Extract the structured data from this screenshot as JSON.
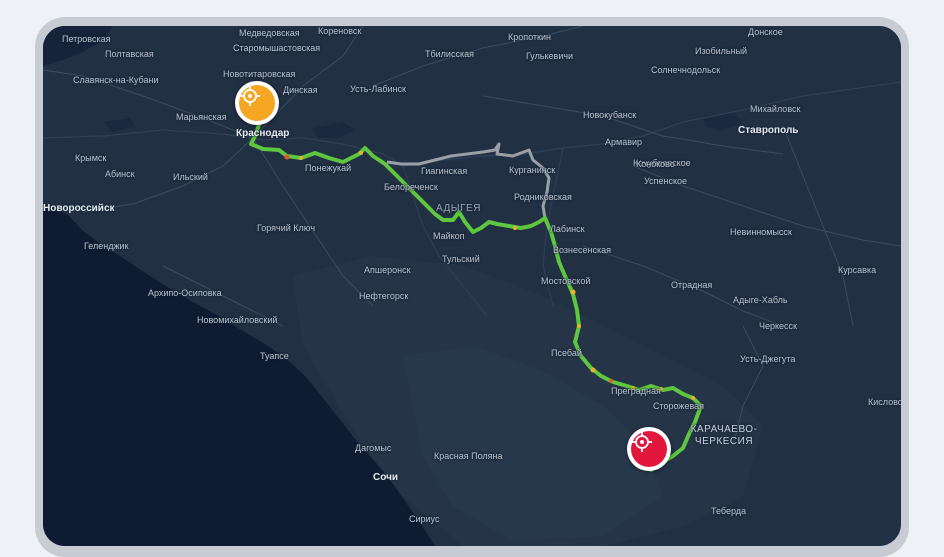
{
  "colors": {
    "water": "#0f1b33",
    "land": "#223044",
    "route": "#5ec63f",
    "alt_route": "#9aa0a7",
    "start_marker": "#f5a623",
    "end_marker": "#e3173e"
  },
  "markers": {
    "start_icon": "crosshair-target-icon",
    "end_icon": "crosshair-target-icon"
  },
  "map_labels": [
    {
      "text": "Петровская",
      "kind": "town"
    },
    {
      "text": "Полтавская",
      "kind": "town"
    },
    {
      "text": "Медведовская",
      "kind": "town"
    },
    {
      "text": "Кореновск",
      "kind": "town"
    },
    {
      "text": "Старомышастовская",
      "kind": "town"
    },
    {
      "text": "Славянск-на-Кубани",
      "kind": "town"
    },
    {
      "text": "Новотитаровская",
      "kind": "town"
    },
    {
      "text": "Динская",
      "kind": "town"
    },
    {
      "text": "Усть-Лабинск",
      "kind": "town"
    },
    {
      "text": "Тбилисская",
      "kind": "town"
    },
    {
      "text": "Кропоткин",
      "kind": "town"
    },
    {
      "text": "Гулькевичи",
      "kind": "town"
    },
    {
      "text": "Донское",
      "kind": "town"
    },
    {
      "text": "Изобильный",
      "kind": "town"
    },
    {
      "text": "Солнечнодольск",
      "kind": "town"
    },
    {
      "text": "Михайловск",
      "kind": "town"
    },
    {
      "text": "Ставрополь",
      "kind": "city"
    },
    {
      "text": "Марьянская",
      "kind": "town"
    },
    {
      "text": "Краснодар",
      "kind": "city"
    },
    {
      "text": "Новокубанск",
      "kind": "town"
    },
    {
      "text": "Армавир",
      "kind": "town"
    },
    {
      "text": "Крымск",
      "kind": "town"
    },
    {
      "text": "Абинск",
      "kind": "town"
    },
    {
      "text": "Ильский",
      "kind": "town"
    },
    {
      "text": "Понежукай",
      "kind": "town"
    },
    {
      "text": "Гиагинская",
      "kind": "town"
    },
    {
      "text": "Курганинск",
      "kind": "town"
    },
    {
      "text": "Кочубеевское",
      "kind": "town"
    },
    {
      "text": "Конокoво",
      "kind": "town"
    },
    {
      "text": "Успенское",
      "kind": "town"
    },
    {
      "text": "Белореченск",
      "kind": "town"
    },
    {
      "text": "Родниковская",
      "kind": "town"
    },
    {
      "text": "Новороссийск",
      "kind": "city"
    },
    {
      "text": "АДЫГЕЯ",
      "kind": "region"
    },
    {
      "text": "Геленджик",
      "kind": "town"
    },
    {
      "text": "Горячий Ключ",
      "kind": "town"
    },
    {
      "text": "Майкоп",
      "kind": "town"
    },
    {
      "text": "Лабинск",
      "kind": "town"
    },
    {
      "text": "Невинномысск",
      "kind": "town"
    },
    {
      "text": "Тульский",
      "kind": "town"
    },
    {
      "text": "Вознесенская",
      "kind": "town"
    },
    {
      "text": "Апшеронск",
      "kind": "town"
    },
    {
      "text": "Курсавка",
      "kind": "town"
    },
    {
      "text": "Архипо-Осиповка",
      "kind": "town"
    },
    {
      "text": "Нефтегорск",
      "kind": "town"
    },
    {
      "text": "Мостовской",
      "kind": "town"
    },
    {
      "text": "Отрадная",
      "kind": "town"
    },
    {
      "text": "Адыге-Хабль",
      "kind": "town"
    },
    {
      "text": "Новомихайловский",
      "kind": "town"
    },
    {
      "text": "Черкесск",
      "kind": "town"
    },
    {
      "text": "Псебай",
      "kind": "town"
    },
    {
      "text": "Туапсе",
      "kind": "town"
    },
    {
      "text": "Усть-Джегута",
      "kind": "town"
    },
    {
      "text": "Преградная",
      "kind": "town"
    },
    {
      "text": "Сторожевая",
      "kind": "town"
    },
    {
      "text": "Кисловодск",
      "kind": "town"
    },
    {
      "text": "КАРАЧАЕВО-",
      "kind": "region"
    },
    {
      "text": "ЧЕРКЕСИЯ",
      "kind": "region"
    },
    {
      "text": "Дагомыс",
      "kind": "town"
    },
    {
      "text": "Красная Поляна",
      "kind": "town"
    },
    {
      "text": "Сочи",
      "kind": "city"
    },
    {
      "text": "Сириус",
      "kind": "town"
    },
    {
      "text": "Теберда",
      "kind": "town"
    }
  ]
}
